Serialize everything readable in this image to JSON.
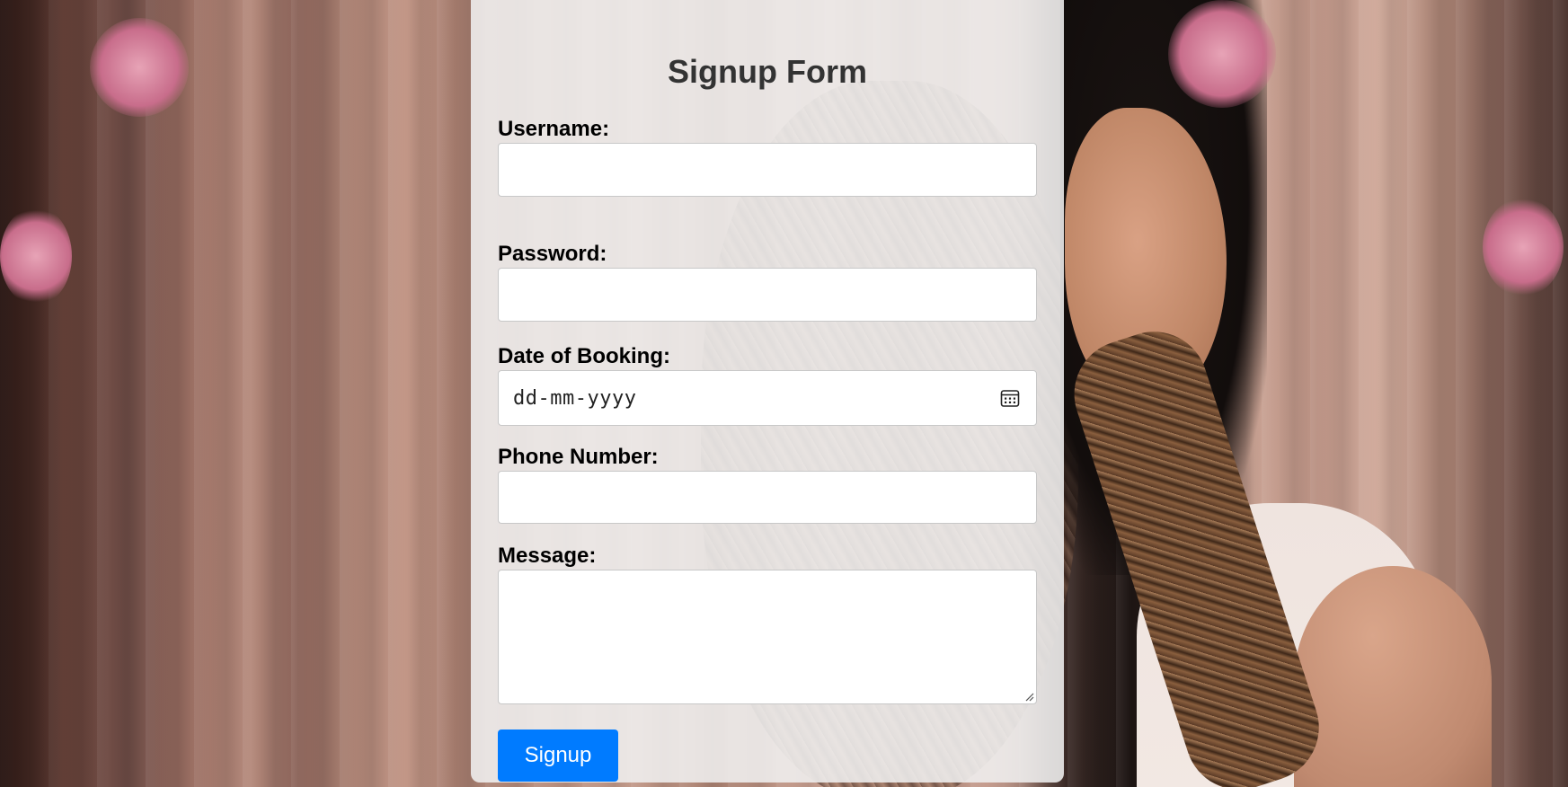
{
  "form": {
    "title": "Signup Form",
    "username_label": "Username:",
    "username_value": "",
    "password_label": "Password:",
    "password_value": "",
    "date_label": "Date of Booking:",
    "date_placeholder": "dd-mm-yyyy",
    "phone_label": "Phone Number:",
    "phone_value": "",
    "message_label": "Message:",
    "message_value": "",
    "submit_label": "Signup"
  },
  "colors": {
    "button_bg": "#007bff",
    "title_text": "#333333",
    "card_bg": "rgba(240,240,240,0.88)"
  },
  "icons": {
    "date_picker": "calendar-icon",
    "textarea_resize": "resize-handle-icon"
  }
}
